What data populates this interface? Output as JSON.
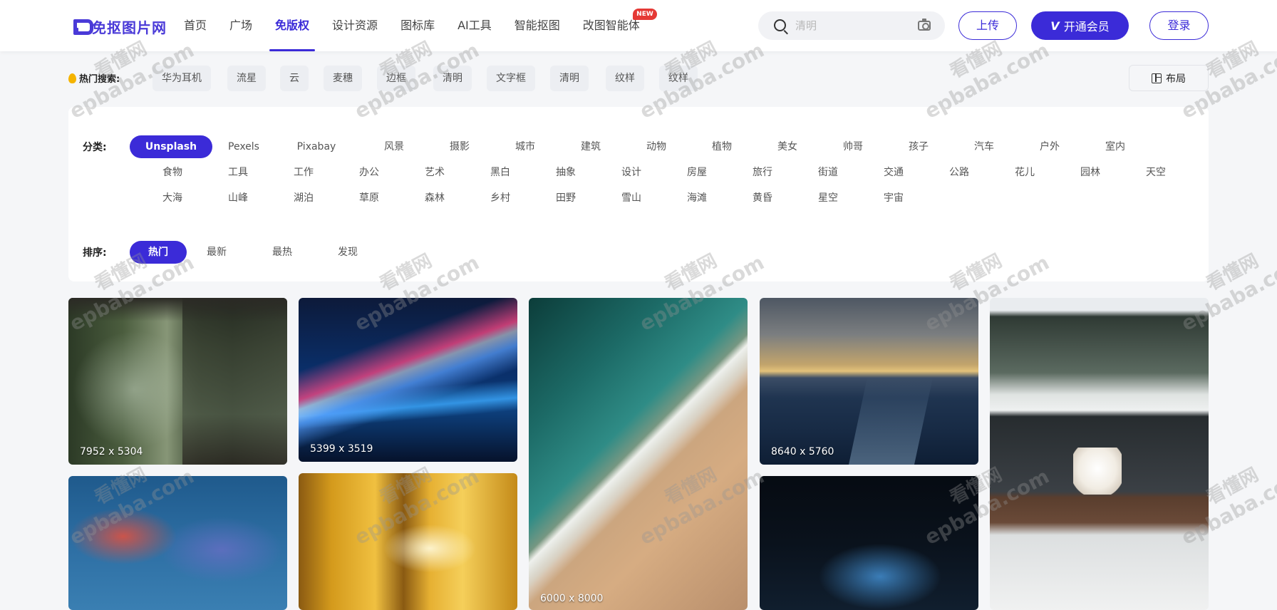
{
  "brand": {
    "logo_text": "免抠图片网"
  },
  "nav": [
    {
      "label": "首页",
      "active": false
    },
    {
      "label": "广场",
      "active": false
    },
    {
      "label": "免版权",
      "active": true
    },
    {
      "label": "设计资源",
      "active": false
    },
    {
      "label": "图标库",
      "active": false
    },
    {
      "label": "AI工具",
      "active": false
    },
    {
      "label": "智能抠图",
      "active": false
    },
    {
      "label": "改图智能体",
      "active": false,
      "badge": "NEW"
    }
  ],
  "search": {
    "placeholder": "清明",
    "icon": "search-icon",
    "camera_icon": "camera-icon"
  },
  "header_buttons": {
    "upload": "上传",
    "vip": "开通会员",
    "login": "登录"
  },
  "hot_search": {
    "label": "热门搜索:",
    "tags": [
      "华为耳机",
      "流星",
      "云",
      "麦穗",
      "边框",
      "清明",
      "文字框",
      "清明",
      "纹样",
      "纹样"
    ]
  },
  "layout_button": "布局",
  "filters": {
    "category_label": "分类:",
    "categories": [
      "Unsplash",
      "Pexels",
      "Pixabay",
      "风景",
      "摄影",
      "城市",
      "建筑",
      "动物",
      "植物",
      "美女",
      "帅哥",
      "孩子",
      "汽车",
      "户外",
      "室内",
      "食物",
      "工具",
      "工作",
      "办公",
      "艺术",
      "黑白",
      "抽象",
      "设计",
      "房屋",
      "旅行",
      "街道",
      "交通",
      "公路",
      "花儿",
      "园林",
      "天空",
      "大海",
      "山峰",
      "湖泊",
      "草原",
      "森林",
      "乡村",
      "田野",
      "雪山",
      "海滩",
      "黄昏",
      "星空",
      "宇宙"
    ],
    "category_active": "Unsplash",
    "sort_label": "排序:",
    "sorts": [
      "热门",
      "最新",
      "最热",
      "发现"
    ],
    "sort_active": "热门"
  },
  "images": [
    {
      "dimensions": "7952 x 5304"
    },
    {
      "dimensions": "5399 x 3519"
    },
    {
      "dimensions": "6000 x 8000"
    },
    {
      "dimensions": "8640 x 5760"
    },
    {
      "dimensions": ""
    },
    {
      "dimensions": ""
    },
    {
      "dimensions": ""
    },
    {
      "dimensions": ""
    }
  ],
  "watermark": {
    "line1": "看懂网",
    "line2": "epbaba.com"
  },
  "colors": {
    "accent": "#3b2bd8",
    "badge": "#e53935"
  }
}
